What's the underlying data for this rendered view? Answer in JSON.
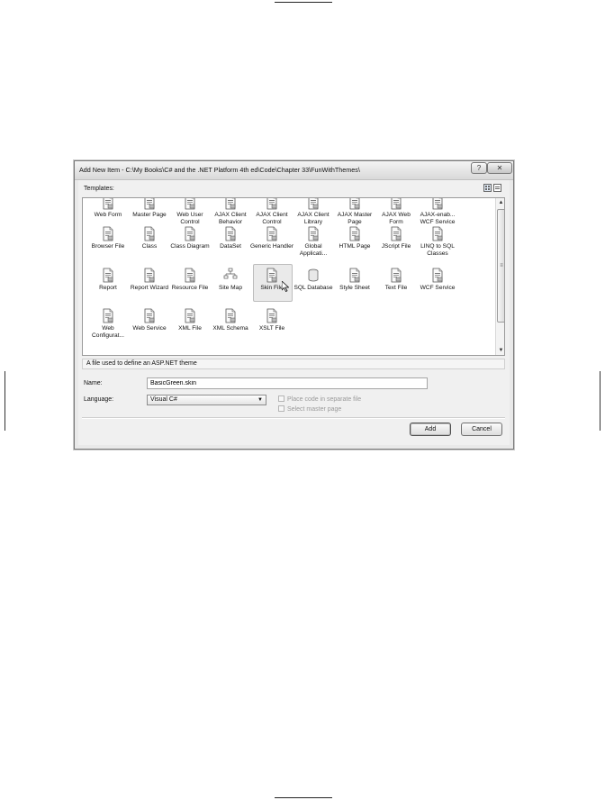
{
  "window": {
    "title": "Add New Item - C:\\My Books\\C# and the .NET Platform 4th ed\\Code\\Chapter 33\\FunWithThemes\\",
    "help_glyph": "?",
    "close_glyph": "✕"
  },
  "templates_label": "Templates:",
  "templates": [
    {
      "label": "Web Form",
      "icon": "web-form-icon"
    },
    {
      "label": "Master Page",
      "icon": "master-page-icon"
    },
    {
      "label": "Web User Control",
      "icon": "web-user-control-icon"
    },
    {
      "label": "AJAX Client Behavior",
      "icon": "ajax-client-behavior-icon"
    },
    {
      "label": "AJAX Client Control",
      "icon": "ajax-client-control-icon"
    },
    {
      "label": "AJAX Client Library",
      "icon": "ajax-client-library-icon"
    },
    {
      "label": "AJAX Master Page",
      "icon": "ajax-master-page-icon"
    },
    {
      "label": "AJAX Web Form",
      "icon": "ajax-web-form-icon"
    },
    {
      "label": "AJAX-enab... WCF Service",
      "icon": "ajax-wcf-service-icon"
    },
    {
      "label": "Browser File",
      "icon": "browser-file-icon"
    },
    {
      "label": "Class",
      "icon": "class-icon"
    },
    {
      "label": "Class Diagram",
      "icon": "class-diagram-icon"
    },
    {
      "label": "DataSet",
      "icon": "dataset-icon"
    },
    {
      "label": "Generic Handler",
      "icon": "generic-handler-icon"
    },
    {
      "label": "Global Applicati...",
      "icon": "global-application-icon"
    },
    {
      "label": "HTML Page",
      "icon": "html-page-icon"
    },
    {
      "label": "JScript File",
      "icon": "jscript-file-icon"
    },
    {
      "label": "LINQ to SQL Classes",
      "icon": "linq-to-sql-icon"
    },
    {
      "label": "Report",
      "icon": "report-icon"
    },
    {
      "label": "Report Wizard",
      "icon": "report-wizard-icon"
    },
    {
      "label": "Resource File",
      "icon": "resource-file-icon"
    },
    {
      "label": "Site Map",
      "icon": "site-map-icon"
    },
    {
      "label": "Skin File",
      "icon": "skin-file-icon",
      "selected": true
    },
    {
      "label": "SQL Database",
      "icon": "sql-database-icon"
    },
    {
      "label": "Style Sheet",
      "icon": "style-sheet-icon"
    },
    {
      "label": "Text File",
      "icon": "text-file-icon"
    },
    {
      "label": "WCF Service",
      "icon": "wcf-service-icon"
    },
    {
      "label": "Web Configurat...",
      "icon": "web-config-icon"
    },
    {
      "label": "Web Service",
      "icon": "web-service-icon"
    },
    {
      "label": "XML File",
      "icon": "xml-file-icon"
    },
    {
      "label": "XML Schema",
      "icon": "xml-schema-icon"
    },
    {
      "label": "XSLT File",
      "icon": "xslt-file-icon"
    }
  ],
  "description": "A file used to define an ASP.NET theme",
  "name_label": "Name:",
  "name_value": "BasicGreen.skin",
  "language_label": "Language:",
  "language_value": "Visual C#",
  "place_code_label": "Place code in separate file",
  "select_master_label": "Select master page",
  "add_label": "Add",
  "cancel_label": "Cancel"
}
